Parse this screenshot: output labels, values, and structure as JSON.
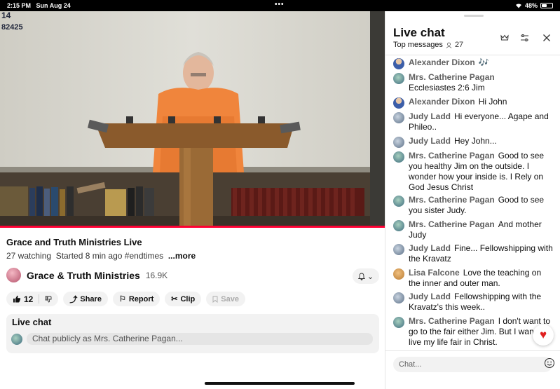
{
  "status_bar": {
    "time": "2:15 PM",
    "date": "Sun Aug 24",
    "dots": "•••",
    "battery_percent": "48%",
    "battery_level": 0.48
  },
  "video": {
    "board_text_line1": "14",
    "board_text_line2": "82425",
    "progress_fraction": 1.0
  },
  "info": {
    "title": "Grace and Truth Ministries Live",
    "watching": "27 watching",
    "started": "Started 8 min ago",
    "hashtag": "#endtimes",
    "more": "...more",
    "channel_name": "Grace & Truth Ministries",
    "subscribers": "16.9K",
    "bell_chevron": "⌄"
  },
  "actions": {
    "like_count": "12",
    "share": "Share",
    "report": "Report",
    "clip": "Clip",
    "save": "Save"
  },
  "chatbox": {
    "label": "Live chat",
    "placeholder": "Chat publicly as Mrs. Catherine Pagan..."
  },
  "chat": {
    "title": "Live chat",
    "subtitle": "Top messages",
    "viewer_count": "27",
    "input_placeholder": "Chat...",
    "messages": [
      {
        "author": "Alexander Dixon",
        "text": "🎶"
      },
      {
        "author": "Mrs. Catherine Pagan",
        "text": "Ecclesiastes 2:6 Jim"
      },
      {
        "author": "Alexander Dixon",
        "text": "Hi John"
      },
      {
        "author": "Judy Ladd",
        "text": "Hi everyone... Agape and Phileo.."
      },
      {
        "author": "Judy Ladd",
        "text": "Hey John..."
      },
      {
        "author": "Mrs. Catherine Pagan",
        "text": "Good to see you healthy Jim on the outside. I wonder how your inside is. I Rely on God Jesus Christ"
      },
      {
        "author": "Mrs. Catherine Pagan",
        "text": "Good to see you sister Judy."
      },
      {
        "author": "Mrs. Catherine Pagan",
        "text": "And mother Judy"
      },
      {
        "author": "Judy Ladd",
        "text": "Fine... Fellowshipping with the Kravatz"
      },
      {
        "author": "Lisa Falcone",
        "text": "Love the teaching on the inner and outer man."
      },
      {
        "author": "Judy Ladd",
        "text": "Fellowshipping with the Kravatz's this week.."
      },
      {
        "author": "Mrs. Catherine Pagan",
        "text": "I don't want to go to the fair either Jim. But I want to live my life fair in Christ."
      }
    ]
  },
  "colors": {
    "progress_red": "#ff0033",
    "heart_red": "#e02020",
    "author_gray": "#606060"
  }
}
